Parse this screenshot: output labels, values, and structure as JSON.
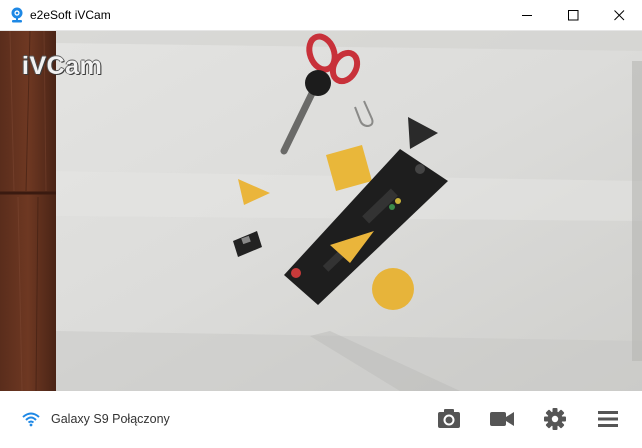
{
  "window": {
    "title": "e2eSoft iVCam",
    "accent_color": "#1e88e5"
  },
  "controls": {
    "minimize_icon": "minimize-icon",
    "maximize_icon": "maximize-icon",
    "close_icon": "close-icon"
  },
  "camera": {
    "watermark": "iVCam"
  },
  "status": {
    "icon": "wifi-icon",
    "text": "Galaxy S9 Połączony"
  },
  "toolbar": {
    "photo_icon": "camera-icon",
    "video_icon": "video-camera-icon",
    "settings_icon": "gear-icon",
    "menu_icon": "hamburger-menu-icon"
  }
}
